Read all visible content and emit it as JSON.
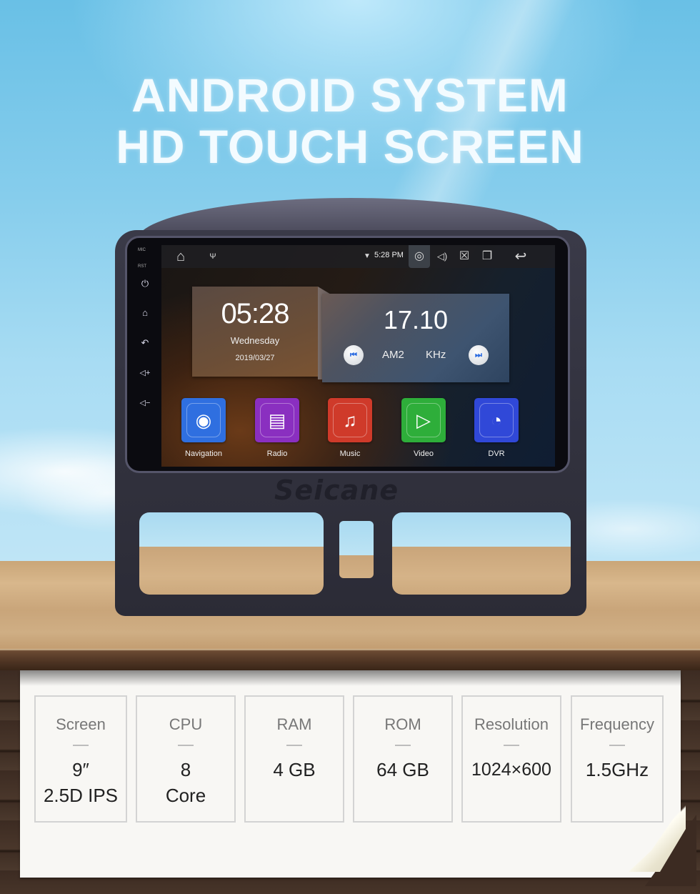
{
  "headline": {
    "line1": "ANDROID SYSTEM",
    "line2": "HD TOUCH SCREEN"
  },
  "brand": "Seicane",
  "head_unit": {
    "side_labels": [
      "MIC",
      "RST"
    ],
    "side_buttons": [
      {
        "name": "power",
        "glyph": "⏻"
      },
      {
        "name": "home",
        "glyph": "⌂"
      },
      {
        "name": "back",
        "glyph": "↶"
      },
      {
        "name": "volume-up",
        "glyph": "◁+"
      },
      {
        "name": "volume-down",
        "glyph": "◁−"
      }
    ],
    "status_bar": {
      "home_glyph": "⌂",
      "usb_glyph": "Ψ",
      "wifi_glyph": "▼",
      "time": "5:28 PM",
      "camera_glyph": "◎",
      "volume_glyph": "◁)",
      "close_glyph": "☒",
      "recents_glyph": "❐",
      "back_glyph": "↩"
    },
    "clock_widget": {
      "time": "05:28",
      "day": "Wednesday",
      "date": "2019/03/27"
    },
    "radio_widget": {
      "frequency": "17.10",
      "band": "AM2",
      "unit": "KHz",
      "prev_glyph": "⏮",
      "next_glyph": "⏭"
    },
    "apps": [
      {
        "label": "Navigation",
        "glyph": "◉",
        "color": "#2f6fe0"
      },
      {
        "label": "Radio",
        "glyph": "▤",
        "color": "#8a2fc0"
      },
      {
        "label": "Music",
        "glyph": "♫",
        "color": "#cf3a2a"
      },
      {
        "label": "Video",
        "glyph": "▷",
        "color": "#2eae3a"
      },
      {
        "label": "DVR",
        "glyph": "◔",
        "color": "#3048d8"
      }
    ]
  },
  "specs": [
    {
      "label": "Screen",
      "value_line1": "9″",
      "value_line2": "2.5D IPS"
    },
    {
      "label": "CPU",
      "value_line1": "8",
      "value_line2": "Core"
    },
    {
      "label": "RAM",
      "value_line1": "4 GB",
      "value_line2": ""
    },
    {
      "label": "ROM",
      "value_line1": "64 GB",
      "value_line2": ""
    },
    {
      "label": "Resolution",
      "value_line1": "1024×600",
      "value_line2": ""
    },
    {
      "label": "Frequency",
      "value_line1": "1.5GHz",
      "value_line2": ""
    }
  ]
}
